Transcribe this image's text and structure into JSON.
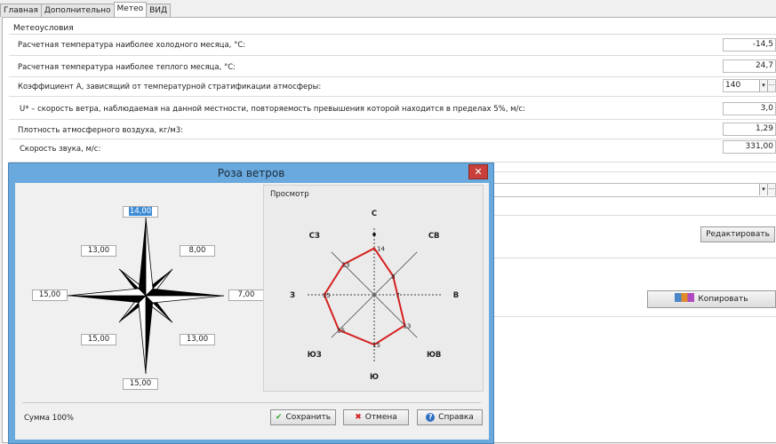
{
  "tabs": [
    "Главная",
    "Дополнительно",
    "Метео",
    "ВИД"
  ],
  "group_title": "Метеоусловия",
  "params": [
    {
      "label": "Расчетная температура наиболее холодного месяца, °C:",
      "value": "-14,5"
    },
    {
      "label": "Расчетная температура наиболее теплого месяца, °C:",
      "value": "24,7"
    },
    {
      "label": "Коэффициент А, зависящий от температурной стратификации атмосферы:",
      "value": "140"
    },
    {
      "label": "U* – скорость ветра, наблюдаемая на данной местности, повторяемость превышения которой находится в пределах 5%, м/с:",
      "value": "3,0"
    },
    {
      "label": "Плотность атмосферного воздуха, кг/м3:",
      "value": "1,29"
    },
    {
      "label": "Скорость звука, м/с:",
      "value": "331,00"
    }
  ],
  "buttons": {
    "edit": "Редактировать",
    "copy": "Копировать"
  },
  "dialog": {
    "title": "Роза ветров",
    "close": "✕",
    "preview_label": "Просмотр",
    "sum_label": "Сумма 100%",
    "save": "Сохранить",
    "cancel": "Отмена",
    "help": "Справка",
    "inputs": {
      "n": "14,00",
      "ne": "8,00",
      "e": "7,00",
      "se": "13,00",
      "s": "15,00",
      "sw": "15,00",
      "w": "15,00",
      "nw": "13,00"
    },
    "directions": {
      "n": "С",
      "ne": "СВ",
      "e": "В",
      "se": "ЮВ",
      "s": "Ю",
      "sw": "ЮЗ",
      "w": "З",
      "nw": "СЗ"
    }
  },
  "chart_data": {
    "type": "radar",
    "categories": [
      "С",
      "СВ",
      "В",
      "ЮВ",
      "Ю",
      "ЮЗ",
      "З",
      "СЗ"
    ],
    "values": [
      14,
      8,
      7,
      13,
      15,
      15,
      15,
      13
    ],
    "point_labels": [
      "14",
      "8",
      "7",
      "13",
      "15",
      "15",
      "15",
      "13"
    ],
    "line_color": "#d62020",
    "max": 20
  }
}
